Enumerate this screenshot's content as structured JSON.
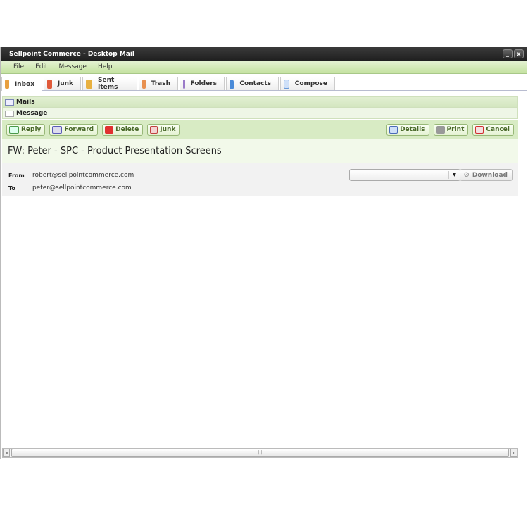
{
  "window": {
    "title": "Sellpoint Commerce - Desktop Mail",
    "minimize": "_",
    "close": "x"
  },
  "menu": [
    "File",
    "Edit",
    "Message",
    "Help"
  ],
  "tabs": [
    {
      "label": "Inbox",
      "icon": "inbox-icon",
      "color": "#e8a040"
    },
    {
      "label": "Junk",
      "icon": "junk-icon",
      "color": "#e05a3a"
    },
    {
      "label": "Sent Items",
      "icon": "sent-items-icon",
      "color": "#e8b040"
    },
    {
      "label": "Trash",
      "icon": "trash-icon",
      "color": "#e89050"
    },
    {
      "label": "Folders",
      "icon": "folders-icon",
      "color": "#9a7ac8"
    },
    {
      "label": "Contacts",
      "icon": "contacts-icon",
      "color": "#4a8ad8"
    },
    {
      "label": "Compose",
      "icon": "compose-icon",
      "color": "#6a9ad8"
    }
  ],
  "panels": {
    "mails": "Mails",
    "message": "Message"
  },
  "toolbar": {
    "reply": "Reply",
    "forward": "Forward",
    "delete": "Delete",
    "junk": "Junk",
    "details": "Details",
    "print": "Print",
    "cancel": "Cancel"
  },
  "message": {
    "subject": "FW: Peter - SPC - Product Presentation Screens",
    "from_label": "From",
    "from": "robert@sellpointcommerce.com",
    "to_label": "To",
    "to": "peter@sellpointcommerce.com",
    "attachment_value": "",
    "download": "Download"
  },
  "scrollbar": {
    "left": "◂",
    "right": "▸",
    "grip": "|||"
  }
}
